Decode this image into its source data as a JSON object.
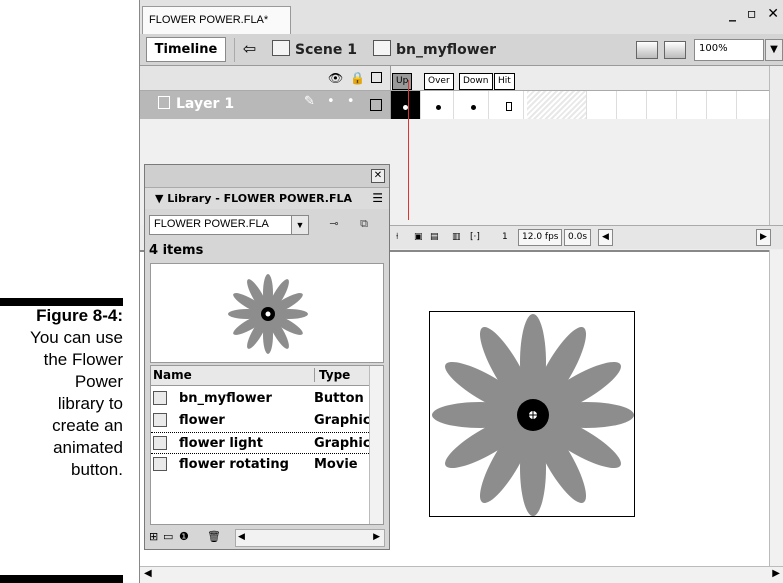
{
  "caption": {
    "figure": "Figure 8-4:",
    "lines": [
      "You can use",
      "the Flower",
      "Power",
      "library to",
      "create an",
      "animated",
      "button."
    ]
  },
  "document": {
    "tab_title": "FLOWER POWER.FLA*",
    "window_controls": "_ ▫ ✕"
  },
  "edit_bar": {
    "timeline_label": "Timeline",
    "back_icon": "⇦",
    "scene_label": "Scene 1",
    "symbol_label": "bn_myflower",
    "zoom_value": "100%"
  },
  "timeline": {
    "layer_name": "Layer 1",
    "frame_labels": [
      "Up",
      "Over",
      "Down",
      "Hit"
    ],
    "current_frame": "1",
    "fps": "12.0 fps",
    "elapsed": "0.0s"
  },
  "library": {
    "title": "▼ Library - FLOWER POWER.FLA",
    "file_select": "FLOWER POWER.FLA",
    "item_count": "4 items",
    "columns": {
      "name": "Name",
      "type": "Type"
    },
    "items": [
      {
        "name": "bn_myflower",
        "type": "Button"
      },
      {
        "name": "flower",
        "type": "Graphic"
      },
      {
        "name": "flower light",
        "type": "Graphic"
      },
      {
        "name": "flower rotating",
        "type": "Movie"
      }
    ]
  },
  "colors": {
    "petal": "#8d8d8d",
    "center": "#000000",
    "frame_up": "#9a9a9a",
    "layer_row": "#b8b8b8"
  }
}
